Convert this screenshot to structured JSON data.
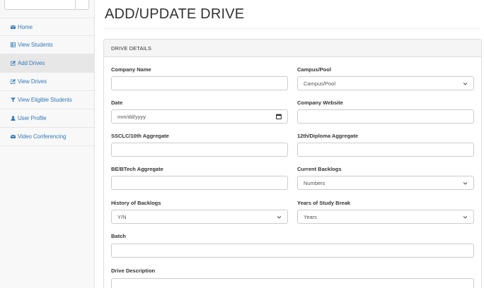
{
  "sidebar": {
    "items": [
      {
        "label": "Home",
        "icon": "envelope-icon"
      },
      {
        "label": "View Students",
        "icon": "list-icon"
      },
      {
        "label": "Add Drives",
        "icon": "edit-icon",
        "active": true
      },
      {
        "label": "View Drives",
        "icon": "edit-icon"
      },
      {
        "label": "View Eligible Students",
        "icon": "filter-icon"
      },
      {
        "label": "User Profile",
        "icon": "user-icon"
      },
      {
        "label": "Video Conferencing",
        "icon": "envelope-icon"
      }
    ]
  },
  "page": {
    "title": "ADD/UPDATE DRIVE"
  },
  "panel": {
    "heading": "DRIVE DETAILS",
    "fields": {
      "company_name": {
        "label": "Company Name",
        "value": ""
      },
      "campus_pool": {
        "label": "Campus/Pool",
        "selected": "Campus/Pool"
      },
      "date": {
        "label": "Date",
        "placeholder": "mm/dd/yyyy"
      },
      "company_website": {
        "label": "Company Website",
        "value": ""
      },
      "ssc_aggregate": {
        "label": "SSCLC/10th Aggregate",
        "value": ""
      },
      "twelfth_aggregate": {
        "label": "12th/Diploma Aggregate",
        "value": ""
      },
      "be_aggregate": {
        "label": "BE/BTech Aggregate",
        "value": ""
      },
      "current_backlogs": {
        "label": "Current Backlogs",
        "selected": "Numbers"
      },
      "history_backlogs": {
        "label": "History of Backlogs",
        "selected": "Y/N"
      },
      "study_break": {
        "label": "Years of Study Break",
        "selected": "Years"
      },
      "batch": {
        "label": "Batch",
        "value": ""
      },
      "drive_description": {
        "label": "Drive Description",
        "value": ""
      }
    }
  },
  "colors": {
    "link": "#337ab7",
    "panel_heading_bg": "#f5f5f5",
    "border": "#cccccc",
    "active_bg": "#e7e7e7"
  }
}
